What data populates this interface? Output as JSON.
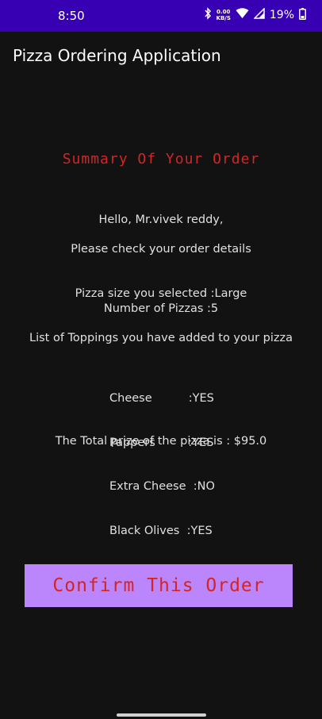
{
  "status_bar": {
    "time": "8:50",
    "net_speed_value": "0.00",
    "net_speed_unit": "KB/S",
    "battery": "19%",
    "icons": [
      "bluetooth-icon",
      "wifi-icon",
      "signal-icon",
      "battery-icon"
    ]
  },
  "app_bar": {
    "title": "Pizza Ordering Application"
  },
  "summary": {
    "heading": "Summary Of Your Order",
    "greeting": "Hello, Mr.vivek reddy,",
    "instruction": "Please check your order details",
    "size_line": "Pizza size you selected :Large",
    "count_line": "Number of Pizzas :5",
    "toppings_heading": "List of Toppings you have added to your pizza",
    "toppings": [
      "Cheese          :YES",
      "Pappers         :YES",
      "Extra Cheese  :NO",
      "Black Olives  :YES"
    ],
    "total_line": "The Total prize of the pizza is : $95.0"
  },
  "actions": {
    "confirm_label": "Confirm This Order"
  },
  "colors": {
    "status_bar": "#3700b3",
    "background": "#121212",
    "accent_red": "#d42424",
    "button_bg": "#bb86fc"
  }
}
